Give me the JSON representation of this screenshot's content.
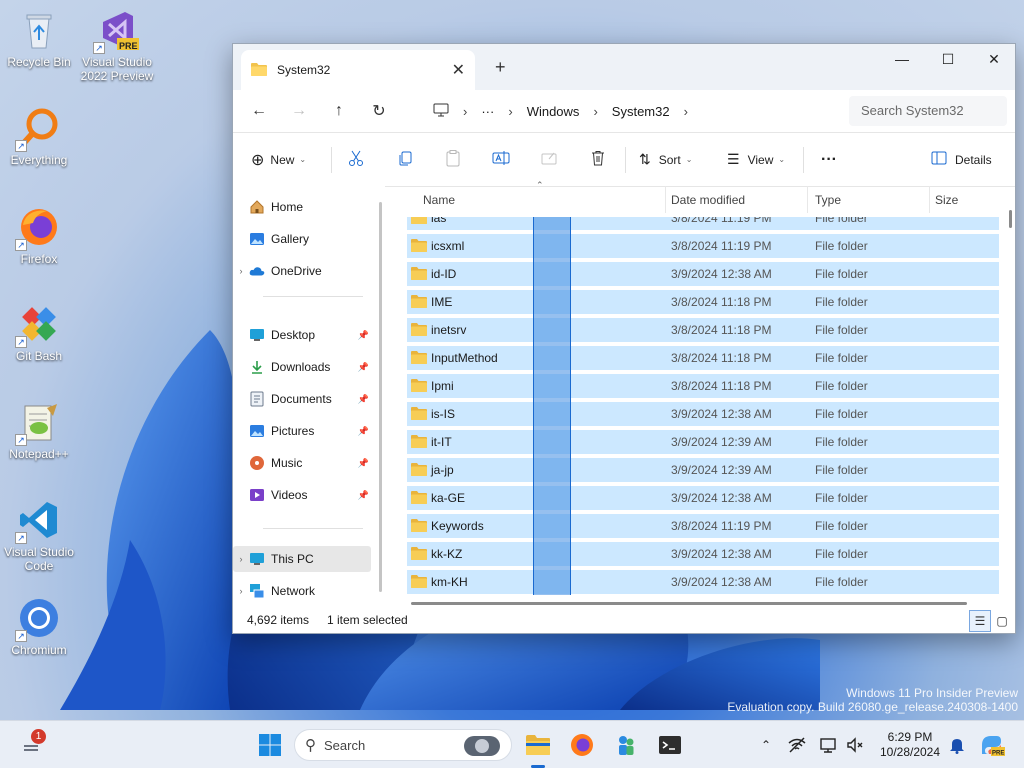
{
  "desktop": {
    "icons": [
      {
        "label": "Recycle Bin",
        "icon": "recycle-bin-icon"
      },
      {
        "label": "Visual Studio 2022 Preview",
        "icon": "visual-studio-preview-icon",
        "badge": "PRE"
      },
      {
        "label": "Everything",
        "icon": "everything-search-icon"
      },
      {
        "label": "Firefox",
        "icon": "firefox-icon"
      },
      {
        "label": "Git Bash",
        "icon": "git-bash-icon"
      },
      {
        "label": "Notepad++",
        "icon": "notepad-plus-plus-icon"
      },
      {
        "label": "Visual Studio Code",
        "icon": "vscode-icon"
      },
      {
        "label": "Chromium",
        "icon": "chromium-icon"
      }
    ],
    "watermark": {
      "line1": "Windows 11 Pro Insider Preview",
      "line2": "Evaluation copy. Build 26080.ge_release.240308-1400"
    }
  },
  "explorer": {
    "tab_title": "System32",
    "new_tab": "+",
    "window_controls": {
      "minimize": "—",
      "maximize": "☐",
      "close": "✕"
    },
    "breadcrumb": [
      "Windows",
      "System32"
    ],
    "breadcrumb_more": "···",
    "search_placeholder": "Search System32",
    "toolbar": {
      "new_label": "New",
      "sort_label": "Sort",
      "view_label": "View",
      "more_label": "···",
      "details_label": "Details"
    },
    "nav": {
      "home": "Home",
      "gallery": "Gallery",
      "onedrive": "OneDrive",
      "desktop": "Desktop",
      "downloads": "Downloads",
      "documents": "Documents",
      "pictures": "Pictures",
      "music": "Music",
      "videos": "Videos",
      "this_pc": "This PC",
      "network": "Network"
    },
    "columns": {
      "name": "Name",
      "date": "Date modified",
      "type": "Type",
      "size": "Size"
    },
    "rows": [
      {
        "name": "ias",
        "date": "3/8/2024 11:19 PM",
        "type": "File folder"
      },
      {
        "name": "icsxml",
        "date": "3/8/2024 11:19 PM",
        "type": "File folder"
      },
      {
        "name": "id-ID",
        "date": "3/9/2024 12:38 AM",
        "type": "File folder"
      },
      {
        "name": "IME",
        "date": "3/8/2024 11:18 PM",
        "type": "File folder"
      },
      {
        "name": "inetsrv",
        "date": "3/8/2024 11:18 PM",
        "type": "File folder"
      },
      {
        "name": "InputMethod",
        "date": "3/8/2024 11:18 PM",
        "type": "File folder"
      },
      {
        "name": "Ipmi",
        "date": "3/8/2024 11:18 PM",
        "type": "File folder"
      },
      {
        "name": "is-IS",
        "date": "3/9/2024 12:38 AM",
        "type": "File folder"
      },
      {
        "name": "it-IT",
        "date": "3/9/2024 12:39 AM",
        "type": "File folder"
      },
      {
        "name": "ja-jp",
        "date": "3/9/2024 12:39 AM",
        "type": "File folder"
      },
      {
        "name": "ka-GE",
        "date": "3/9/2024 12:38 AM",
        "type": "File folder"
      },
      {
        "name": "Keywords",
        "date": "3/8/2024 11:19 PM",
        "type": "File folder"
      },
      {
        "name": "kk-KZ",
        "date": "3/9/2024 12:38 AM",
        "type": "File folder"
      },
      {
        "name": "km-KH",
        "date": "3/9/2024 12:38 AM",
        "type": "File folder"
      }
    ],
    "status": {
      "item_count": "4,692 items",
      "selection": "1 item selected"
    }
  },
  "taskbar": {
    "search_label": "Search",
    "notification_count": "1",
    "time": "6:29 PM",
    "date": "10/28/2024"
  },
  "colors": {
    "selection_row": "#cce8ff",
    "marquee": "#408ce1",
    "accent": "#1a6ad0",
    "folder": "#f2c34d"
  }
}
